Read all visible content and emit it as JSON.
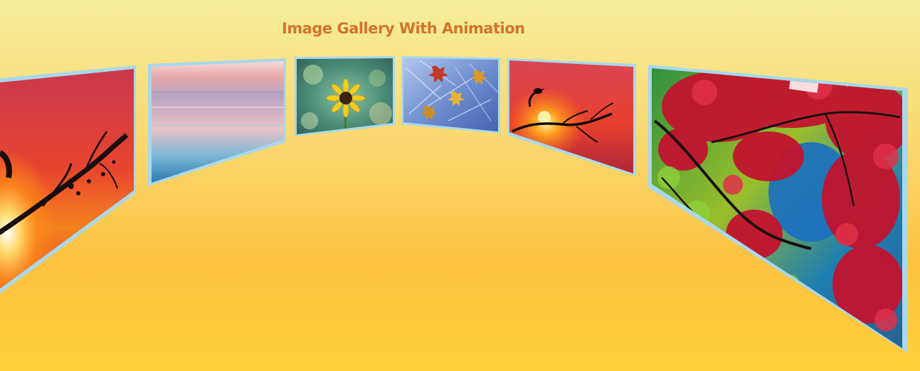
{
  "page": {
    "title": "Image Gallery With Animation"
  },
  "colors": {
    "title": "#d2742e",
    "frame": "#a9d8ea",
    "background_top": "#f5ee9d",
    "background_bottom": "#ffcf3a"
  },
  "gallery": {
    "items": [
      {
        "name": "sunset-branch-image",
        "subject": "sunset with tree branch silhouette"
      },
      {
        "name": "pastel-sea-image",
        "subject": "calm pastel sea at dusk"
      },
      {
        "name": "sunflower-image",
        "subject": "yellow sunflower"
      },
      {
        "name": "autumn-leaves-ice-image",
        "subject": "autumn leaves on ice"
      },
      {
        "name": "sunset-bird-branch-image",
        "subject": "bird on branch at sunset"
      },
      {
        "name": "red-maple-tree-image",
        "subject": "red maple leaves over water"
      }
    ]
  }
}
